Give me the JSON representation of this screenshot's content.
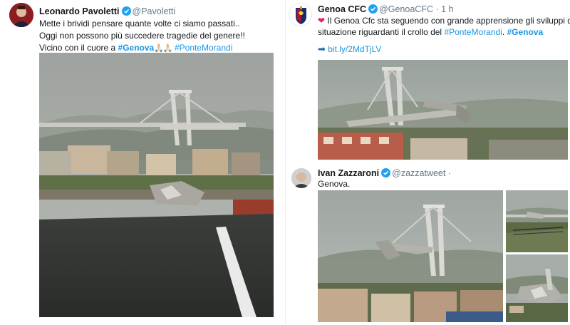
{
  "tweet_left": {
    "name": "Leonardo Pavoletti",
    "handle": "@Pavoletti",
    "lines": [
      "Mette i brividi pensare quante volte ci siamo passati..",
      "Oggi non possono più succedere tragedie del genere!!"
    ],
    "line3_prefix": "Vicino con il cuore a ",
    "hashtag1": "#Genova",
    "emoji": "🙏🏻🙏🏻",
    "hashtag2": "#PonteMorandi"
  },
  "tweet_genoa": {
    "name": "Genoa CFC",
    "handle": "@GenoaCFC",
    "separator": "·",
    "time": "1 h",
    "heart": "❤",
    "line1": "Il Genoa Cfc sta seguendo con grande apprensione gli sviluppi della",
    "line2_prefix": "situazione riguardanti il crollo del ",
    "hashtag1": "#PonteMorandi",
    "line2_mid": ". ",
    "hashtag2": "#Genova",
    "link_arrow": "➡",
    "link_text": "bit.ly/2MdTjLV"
  },
  "tweet_ivan": {
    "name": "Ivan Zazzaroni",
    "handle": "@zazzatweet",
    "separator": "·",
    "text": "Genova."
  },
  "icons": {
    "verified": "verified-badge-icon",
    "link_arrow": "arrow-right-icon",
    "heart": "heart-icon"
  },
  "colors": {
    "link": "#1b95e0",
    "verified": "#1da1f2",
    "heart": "#e0245e"
  }
}
